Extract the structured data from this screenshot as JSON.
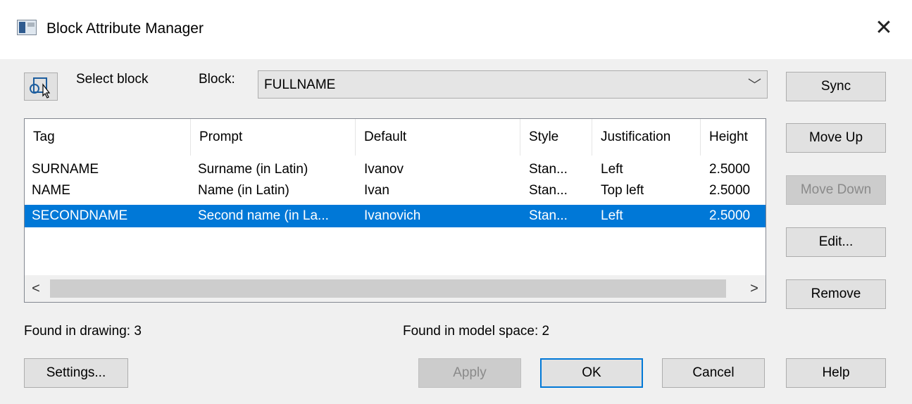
{
  "title": "Block Attribute Manager",
  "close_label": "✕",
  "select_block": {
    "label": "Select block"
  },
  "block": {
    "label": "Block:",
    "value": "FULLNAME"
  },
  "combo_arrow": "﹀",
  "buttons": {
    "sync": "Sync",
    "move_up": "Move Up",
    "move_down": "Move Down",
    "edit": "Edit...",
    "remove": "Remove",
    "settings": "Settings...",
    "apply": "Apply",
    "ok": "OK",
    "cancel": "Cancel",
    "help": "Help"
  },
  "table": {
    "columns": [
      "Tag",
      "Prompt",
      "Default",
      "Style",
      "Justification",
      "Height"
    ],
    "rows": [
      [
        "SURNAME",
        "Surname (in Latin)",
        "Ivanov",
        "Stan...",
        "Left",
        "2.5000"
      ],
      [
        "NAME",
        "Name (in Latin)",
        "Ivan",
        "Stan...",
        "Top left",
        "2.5000"
      ],
      [
        "SECONDNAME",
        "Second name (in La...",
        "Ivanovich",
        "Stan...",
        "Left",
        "2.5000"
      ]
    ],
    "selected_row": 2
  },
  "scroll": {
    "left": "<",
    "right": ">"
  },
  "status": {
    "found_in_drawing": "Found in drawing: 3",
    "found_in_model_space": "Found in model space: 2"
  },
  "icons": {
    "app": "block-attribute-manager-app-icon",
    "select": "select-object-cursor-icon",
    "close": "close-icon",
    "dropdown": "chevron-down-icon"
  },
  "colors": {
    "selection": "#0078d7",
    "default_button_border": "#0078d7"
  }
}
